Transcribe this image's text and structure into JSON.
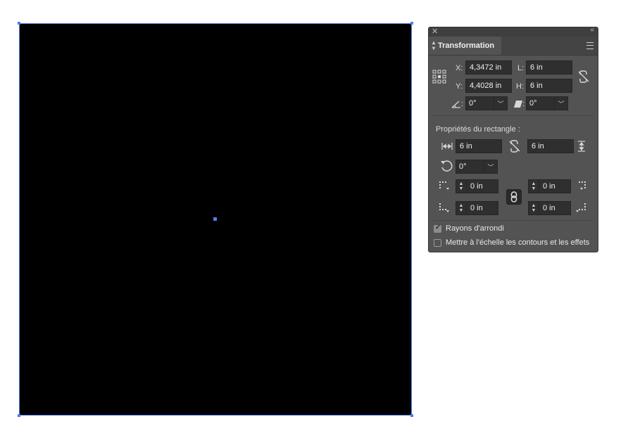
{
  "panel": {
    "tab_title": "Transformation",
    "x_label": "X:",
    "x_value": "4,3472 in",
    "y_label": "Y:",
    "y_value": "4,4028 in",
    "w_label": "L:",
    "w_value": "6 in",
    "h_label": "H:",
    "h_value": "6 in",
    "rotation_value": "0°",
    "shear_value": "0°",
    "colon": ":",
    "rect_props_title": "Propriétés du rectangle :",
    "rect_width": "6 in",
    "rect_height": "6 in",
    "rect_rotation": "0°",
    "corner_tl": "0 in",
    "corner_tr": "0 in",
    "corner_bl": "0 in",
    "corner_br": "0 in",
    "scale_corners_label": "Rayons d'arrondi",
    "scale_corners_checked": true,
    "scale_strokes_label": "Mettre à l'échelle les contours et les effets",
    "scale_strokes_checked": false
  },
  "colors": {
    "selection": "#4f7fe6",
    "panel_bg": "#535353",
    "field_bg": "#2f2f2f"
  }
}
